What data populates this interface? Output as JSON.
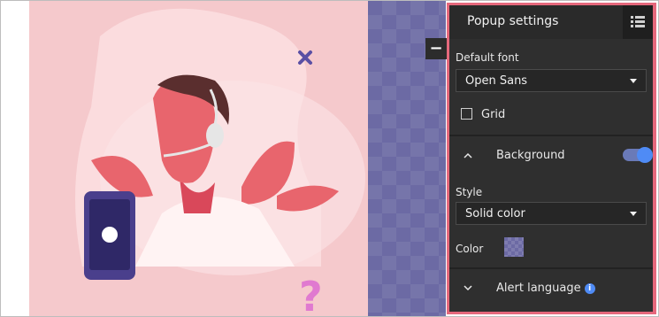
{
  "panel": {
    "title": "Popup settings",
    "default_font_label": "Default font",
    "default_font_value": "Open Sans",
    "grid_label": "Grid",
    "grid_checked": false,
    "background_section_label": "Background",
    "background_toggle_on": true,
    "style_label": "Style",
    "style_value": "Solid color",
    "color_label": "Color",
    "color_value": "#6c6aa4",
    "alert_language_label": "Alert language",
    "grid_view_icon": "grid-view-icon",
    "info_icon": "info-icon",
    "info_icon_glyph": "i"
  },
  "preview": {
    "close_icon": "close-x-icon",
    "collapse_label": "−",
    "question_mark": "?",
    "accent_color": "#e85e6a",
    "background_color": "#f5c9cc"
  }
}
